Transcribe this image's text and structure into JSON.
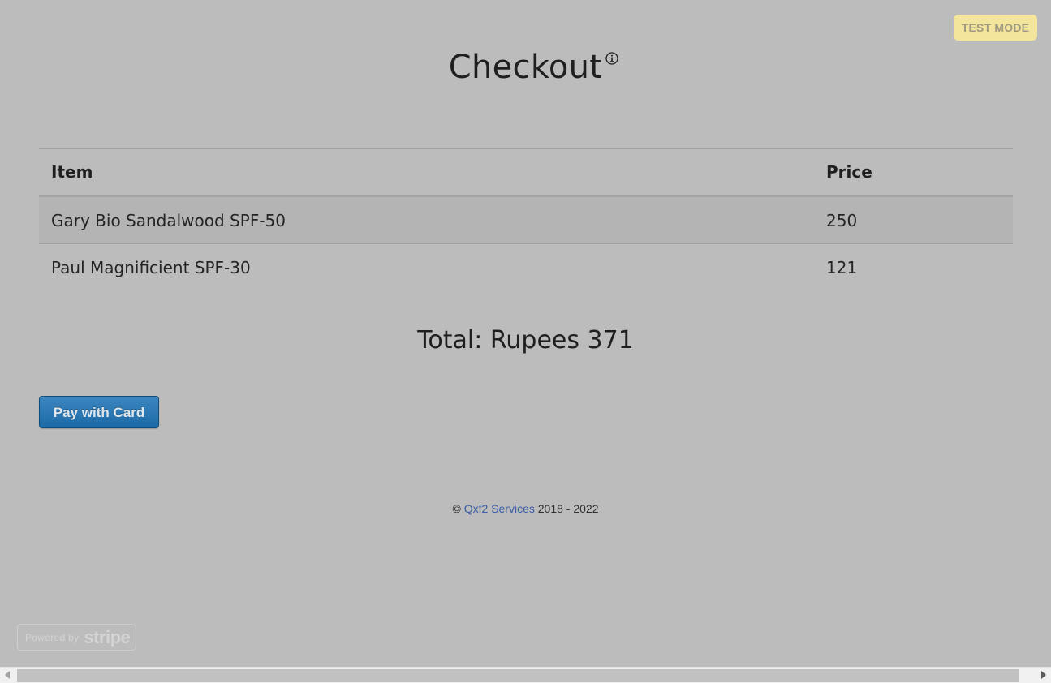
{
  "badge": {
    "test_mode": "TEST MODE"
  },
  "header": {
    "title": "Checkout"
  },
  "cart": {
    "columns": [
      "Item",
      "Price"
    ],
    "rows": [
      {
        "item": "Gary Bio Sandalwood SPF-50",
        "price": "250"
      },
      {
        "item": "Paul Magnificient SPF-30",
        "price": "121"
      }
    ]
  },
  "summary": {
    "total": "Total: Rupees 371"
  },
  "actions": {
    "pay_label": "Pay with Card"
  },
  "footer": {
    "copyright": "©",
    "company": "Qxf2 Services",
    "years": "2018 - 2022"
  },
  "stripe_badge": {
    "powered": "Powered by",
    "brand": "stripe"
  },
  "colors": {
    "background": "#bcbcbc",
    "test_mode_bg": "#f3e59c",
    "pay_button": "#1b6aa6",
    "link": "#3a5da6"
  },
  "icons": {
    "info": "info-circle-icon"
  }
}
